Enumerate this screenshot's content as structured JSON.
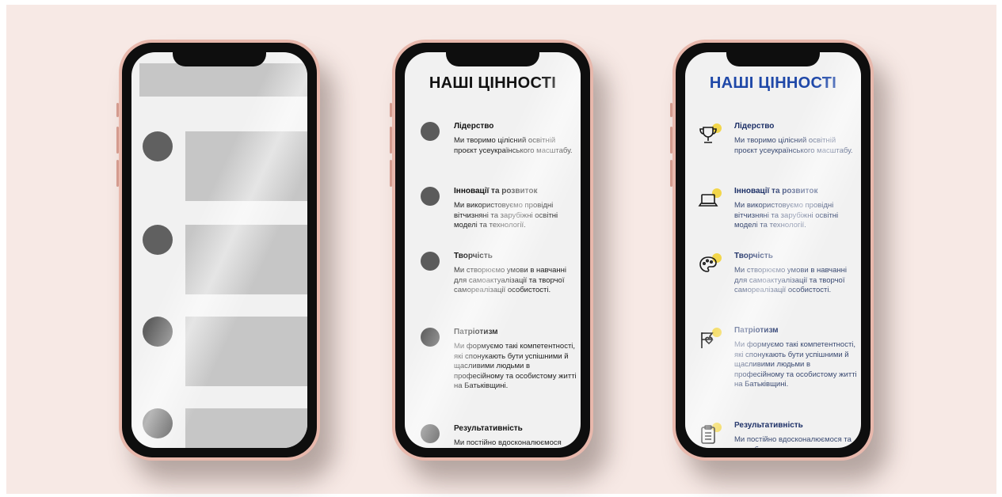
{
  "background_color": "#f7e9e5",
  "accent_color": "#1f48a8",
  "icon_dot_color": "#f2d64b",
  "screen2": {
    "title": "НАШІ ЦІННОСТІ",
    "items": [
      {
        "title": "Лідерство",
        "desc": "Ми творимо цілісний освітній проєкт усеукраїнського масштабу."
      },
      {
        "title": "Інновації та розвиток",
        "desc": "Ми використовуємо провідні вітчизняні та зарубіжні освітні моделі та технології."
      },
      {
        "title": "Творчість",
        "desc": "Ми створюємо умови в навчанні для самоактуалізації та творчої самореалізації особистості."
      },
      {
        "title": "Патріотизм",
        "desc": "Ми формуємо такі компетентності, які спонукають бути успішними й щасливими людьми в професійному та особистому житті на Батьківщині."
      },
      {
        "title": "Результативність",
        "desc": "Ми постійно вдосконалюємося"
      }
    ]
  },
  "screen3": {
    "title": "НАШІ ЦІННОСТІ",
    "items": [
      {
        "title": "Лідерство",
        "desc": "Ми творимо цілісний освітній проєкт усеукраїнського масштабу.",
        "icon": "trophy-icon"
      },
      {
        "title": "Інновації та розвиток",
        "desc": "Ми використовуємо провідні вітчизняні та зарубіжні освітні моделі та технології.",
        "icon": "laptop-icon"
      },
      {
        "title": "Творчість",
        "desc": "Ми створюємо умови в навчанні для самоактуалізації та творчої самореалізації особистості.",
        "icon": "palette-icon"
      },
      {
        "title": "Патріотизм",
        "desc": "Ми формуємо такі компетентності, які спонукають бути успішними й щасливими людьми в професійному та особистому житті на Батьківщині.",
        "icon": "flag-heart-icon"
      },
      {
        "title": "Результативність",
        "desc": "Ми постійно вдосконалюємося та розробляємо продукти в",
        "icon": "clipboard-icon"
      }
    ]
  }
}
